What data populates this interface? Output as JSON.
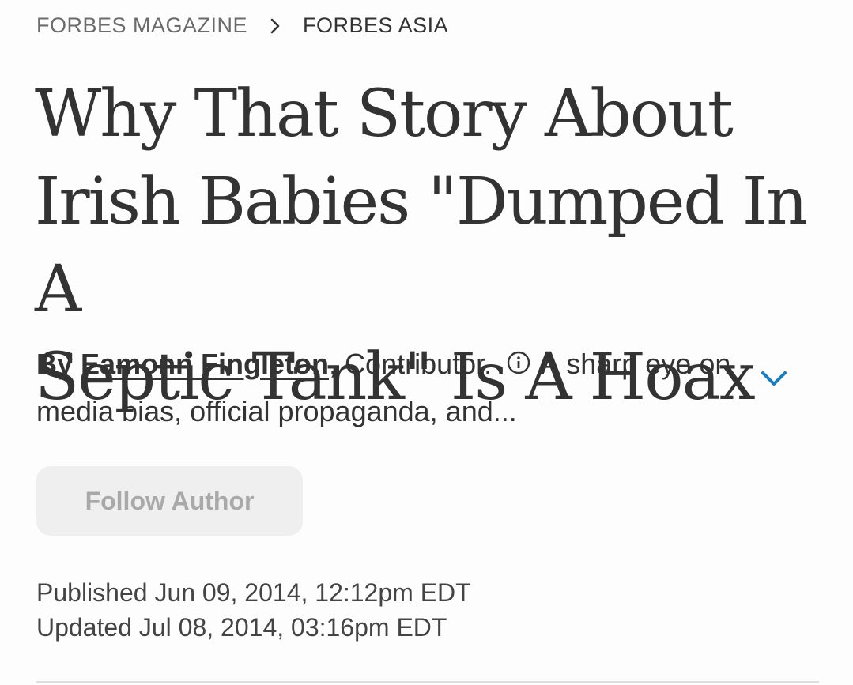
{
  "breadcrumb": {
    "items": [
      "FORBES MAGAZINE",
      "FORBES ASIA"
    ]
  },
  "article": {
    "headline_lines": [
      "Why That Story About",
      "Irish Babies \"Dumped In A",
      "Septic Tank\" Is A Hoax"
    ],
    "byline": {
      "by_label": "By",
      "author": "Eamonn Fingleton",
      "author_suffix": ",",
      "role": "Contributor.",
      "bio_snippet": "A sharp eye on media bias, official propaganda, and..."
    },
    "follow_label": "Follow Author",
    "published": "Published Jun 09, 2014, 12:12pm EDT",
    "updated": "Updated Jul 08, 2014, 03:16pm EDT"
  },
  "icons": {
    "breadcrumb_separator": "chevron-right-icon",
    "info": "info-circle-icon",
    "expand": "chevron-down-icon"
  },
  "colors": {
    "text": "#333333",
    "breadcrumb_muted": "#6b6b6b",
    "accent": "#1a7bbd",
    "button_bg": "#efefef",
    "button_text": "#a9a9a9"
  }
}
